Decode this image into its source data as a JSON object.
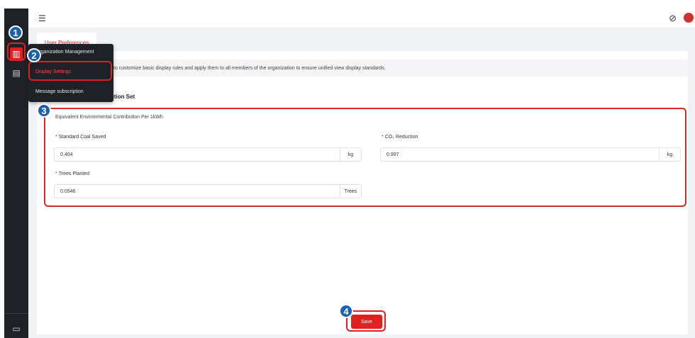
{
  "sidebar": {
    "icons": [
      "building-icon",
      "clipboard-icon",
      "monitor-icon"
    ]
  },
  "topbar": {
    "menu_toggle": "☰",
    "globe": "⊘"
  },
  "tabs": [
    {
      "label": "User Preferences"
    }
  ],
  "menu": {
    "items": [
      {
        "label": "Organization Management"
      },
      {
        "label": "Display Settings"
      },
      {
        "label": "Message subscription"
      }
    ]
  },
  "notice": {
    "text": "to customize basic display rules and apply them to all members of the organization to ensure unified view display standards."
  },
  "section": {
    "title": "ution Set"
  },
  "environment": {
    "subtitle": "Equivalent Environmental Contribution Per 1kWh",
    "fields": [
      {
        "label": "Standard Coal Saved",
        "value": "0.404",
        "unit": "kg"
      },
      {
        "label": "CO₂ Reduction",
        "value": "0.997",
        "unit": "kg"
      },
      {
        "label": "Trees Planted",
        "value": "0.0546",
        "unit": "Trees"
      }
    ]
  },
  "badges": [
    "1",
    "2",
    "3",
    "4"
  ],
  "actions": {
    "save_label": "Save"
  },
  "colors": {
    "accent": "#e02020",
    "badge": "#1b5fb0",
    "sidebar": "#1e2126"
  }
}
